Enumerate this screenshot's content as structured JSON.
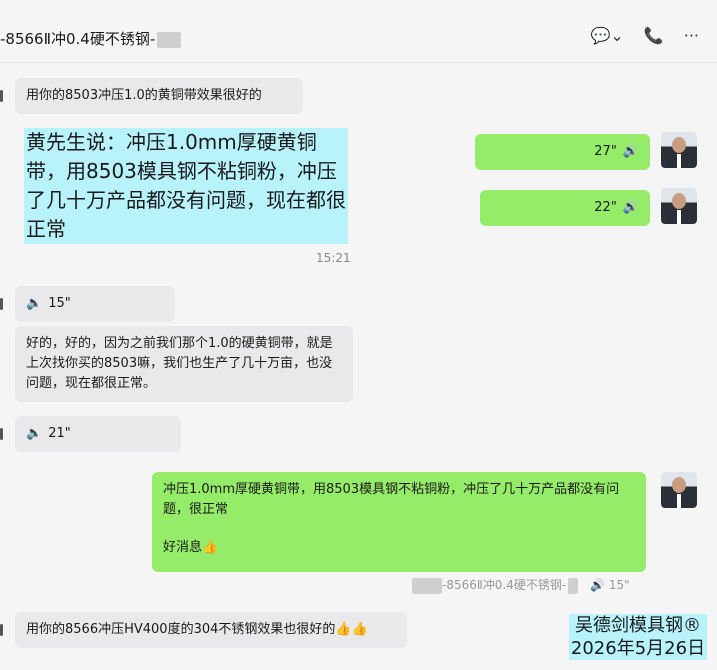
{
  "header": {
    "title": "-8566Ⅱ冲0.4硬不锈钢-",
    "icons": [
      "chat-icon",
      "phone-icon",
      "more-icon"
    ]
  },
  "messages": {
    "m1": "用你的8503冲压1.0的黄铜带效果很好的",
    "highlight_note": "黄先生说：冲压1.0mm厚硬黄铜带，用8503模具钢不粘铜粉，冲压了几十万产品都没有问题，现在都很正常",
    "voice_out1": "27\"",
    "voice_out2": "22\"",
    "time1": "15:21",
    "voice_in1": "15\"",
    "m2": "好的，好的，因为之前我们那个1.0的硬黄铜带，就是上次找你买的8503嘛，我们也生产了几十万亩，也没问题，现在都很正常。",
    "voice_in2": "21\"",
    "m3_line1": "冲压1.0mm厚硬黄铜带，用8503模具钢不粘铜粉，冲压了几十万产品都没有问题，很正常",
    "m3_line2": "好消息👍",
    "quote": "-8566Ⅱ冲0.4硬不锈钢-",
    "quote_voice": "15\"",
    "m4": "用你的8566冲压HV400度的304不锈钢效果也很好的👍👍"
  },
  "watermark": {
    "line1": "吴德剑模具钢®",
    "line2": "2026年5月26日"
  }
}
